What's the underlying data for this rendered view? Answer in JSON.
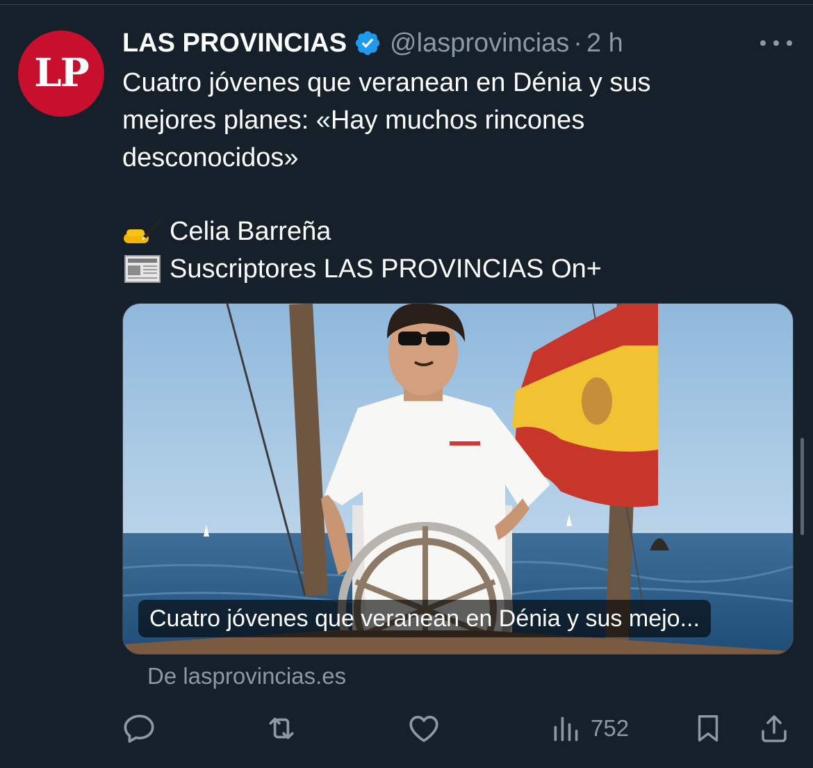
{
  "colors": {
    "background": "#15202b",
    "text_primary": "#ffffff",
    "text_secondary": "#8b98a5",
    "verified_badge": "#1d9bf0",
    "avatar_bg": "#c8102e"
  },
  "tweet": {
    "avatar_text": "LP",
    "display_name": "LAS PROVINCIAS",
    "handle": "@lasprovincias",
    "separator": "·",
    "time": "2 h",
    "text_lines": [
      "Cuatro jóvenes que veranean en Dénia y sus",
      "mejores planes: «Hay muchos rincones",
      "desconocidos»"
    ],
    "author_line": {
      "icon": "writing-hand-icon",
      "text": "Celia Barreña"
    },
    "subscriber_line": {
      "icon": "newspaper-icon",
      "text": "Suscriptores LAS PROVINCIAS On+"
    }
  },
  "card": {
    "image_description_icon": "photo-man-on-sailboat",
    "caption": "Cuatro jóvenes que veranean en Dénia y sus mejo...",
    "source": "De lasprovincias.es"
  },
  "actions": {
    "reply_icon": "reply-icon",
    "retweet_icon": "retweet-icon",
    "like_icon": "heart-icon",
    "views_icon": "views-chart-icon",
    "views_count": "752",
    "bookmark_icon": "bookmark-icon",
    "share_icon": "share-icon"
  }
}
